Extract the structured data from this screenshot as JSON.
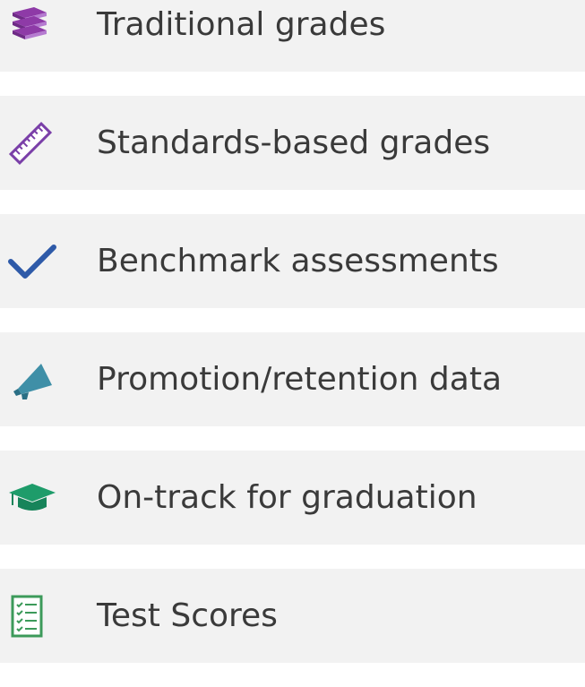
{
  "items": [
    {
      "label": "Traditional grades",
      "icon": "book-stack-icon",
      "color": "#8e3aa7"
    },
    {
      "label": "Standards-based grades",
      "icon": "ruler-icon",
      "color": "#7a3fa8"
    },
    {
      "label": "Benchmark assessments",
      "icon": "checkmark-icon",
      "color": "#2e5aa8"
    },
    {
      "label": "Promotion/retention data",
      "icon": "megaphone-icon",
      "color": "#3f8fa7"
    },
    {
      "label": "On-track for graduation",
      "icon": "graduation-cap-icon",
      "color": "#1e9c6a"
    },
    {
      "label": "Test Scores",
      "icon": "checklist-icon",
      "color": "#3c9a5a"
    }
  ]
}
